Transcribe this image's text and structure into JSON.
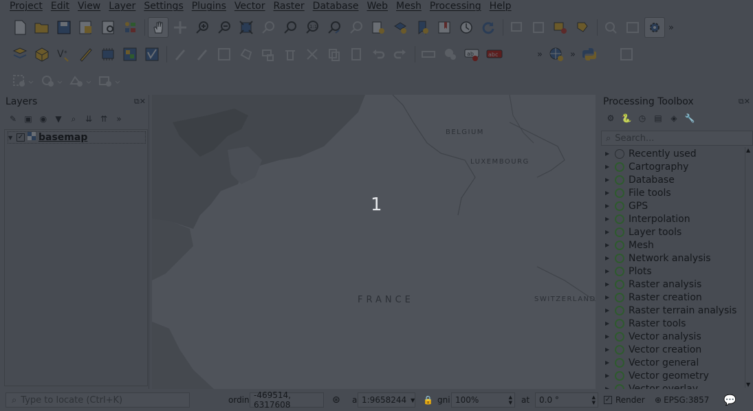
{
  "menubar": {
    "items": [
      "Project",
      "Edit",
      "View",
      "Layer",
      "Settings",
      "Plugins",
      "Vector",
      "Raster",
      "Database",
      "Web",
      "Mesh",
      "Processing",
      "Help"
    ]
  },
  "icons": {
    "toolbar1": [
      "new-project-icon",
      "open-project-icon",
      "save-project-icon",
      "save-as-icon",
      "print-layout-icon",
      "style-manager-icon",
      "pan-icon",
      "pan-to-selection-icon",
      "zoom-in-icon",
      "zoom-out-icon",
      "zoom-full-icon",
      "zoom-to-selection-icon",
      "zoom-to-layer-icon",
      "zoom-native-icon",
      "zoom-last-icon",
      "zoom-next-icon",
      "new-map-view-icon",
      "new-3d-view-icon",
      "new-bookmark-icon",
      "show-bookmarks-icon",
      "temporal-icon",
      "refresh-icon",
      "identify-icon",
      "select-icon",
      "deselect-icon",
      "attribute-table-icon",
      "measure-icon",
      "statistics-icon",
      "gear-icon"
    ],
    "toolbar2": [
      "data-source-manager-icon",
      "new-geopackage-icon",
      "new-shapefile-icon",
      "digitize-icon",
      "new-memory-layer-icon",
      "new-virtual-layer-icon",
      "new-spatialite-icon",
      "edit-pencil-icon",
      "toggle-editing-icon",
      "save-edits-icon",
      "add-feature-icon",
      "vertex-tool-icon",
      "delete-icon",
      "cut-icon",
      "copy-icon",
      "paste-icon",
      "undo-icon",
      "redo-icon",
      "label-icon",
      "label-pin-icon",
      "label-abc-icon",
      "plugins-icon",
      "python-icon",
      "layout-icon"
    ],
    "toolbar3": [
      "add-ring-icon",
      "add-part-icon",
      "fill-ring-icon",
      "delete-ring-icon"
    ]
  },
  "layers_panel": {
    "title": "Layers",
    "layer_name": "basemap",
    "checked": true
  },
  "map": {
    "overlay_number": "1",
    "labels": {
      "belgium": "BELGIUM",
      "luxembourg": "LUXEMBOURG",
      "france": "FRANCE",
      "switzerland": "SWITZERLAND"
    }
  },
  "toolbox": {
    "title": "Processing Toolbox",
    "search_placeholder": "Search...",
    "items": [
      "Recently used",
      "Cartography",
      "Database",
      "File tools",
      "GPS",
      "Interpolation",
      "Layer tools",
      "Mesh",
      "Network analysis",
      "Plots",
      "Raster analysis",
      "Raster creation",
      "Raster terrain analysis",
      "Raster tools",
      "Vector analysis",
      "Vector creation",
      "Vector general",
      "Vector geometry",
      "Vector overlay"
    ]
  },
  "statusbar": {
    "locator_placeholder": "Type to locate (Ctrl+K)",
    "coordinate_label": "ordin",
    "coordinate_value": "-469514, 6317608",
    "scale_label": "a",
    "scale_value": "1:9658244",
    "magnifier_label": "gni",
    "magnifier_value": "100%",
    "rotation_label": "at",
    "rotation_value": "0.0 °",
    "render_label": "Render",
    "crs": "EPSG:3857"
  }
}
